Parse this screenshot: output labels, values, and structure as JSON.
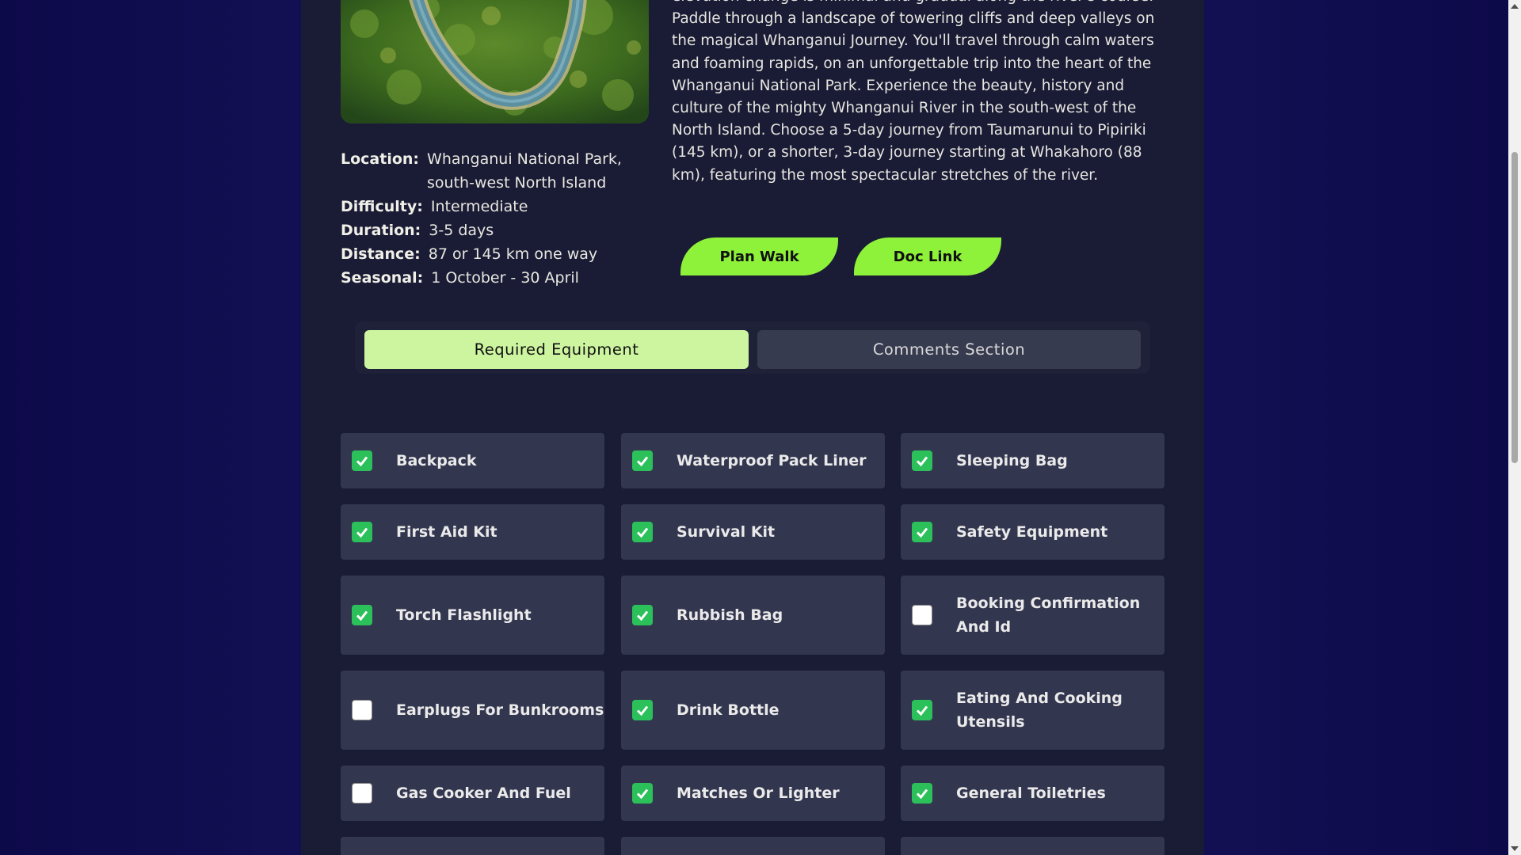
{
  "track": {
    "image_alt": "Whanganui River bend aerial view",
    "description": "elevation change is minimal and gradual along the river's course. Paddle through a landscape of towering cliffs and deep valleys on the magical Whanganui Journey. You'll travel through calm waters and foaming rapids, on an unforgettable trip into the heart of the Whanganui National Park. Experience the beauty, history and culture of the mighty Whanganui River in the south-west of the North Island. Choose a 5-day journey from Taumarunui to Pipiriki (145 km), or a shorter, 3-day journey starting at Whakahoro (88 km), featuring the most spectacular stretches of the river.",
    "info": [
      {
        "label": "Location:",
        "value": "Whanganui National Park, south-west North Island"
      },
      {
        "label": "Difficulty:",
        "value": "Intermediate"
      },
      {
        "label": "Duration:",
        "value": "3-5 days"
      },
      {
        "label": "Distance:",
        "value": "87 or 145 km one way"
      },
      {
        "label": "Seasonal:",
        "value": "1 October - 30 April"
      }
    ]
  },
  "buttons": {
    "plan_walk": "Plan Walk",
    "doc_link": "Doc Link"
  },
  "tabs": {
    "required_equipment": "Required Equipment",
    "comments_section": "Comments Section"
  },
  "equipment": [
    {
      "label": "Backpack",
      "checked": true
    },
    {
      "label": "Waterproof Pack Liner",
      "checked": true
    },
    {
      "label": "Sleeping Bag",
      "checked": true
    },
    {
      "label": "First Aid Kit",
      "checked": true
    },
    {
      "label": "Survival Kit",
      "checked": true
    },
    {
      "label": "Safety Equipment",
      "checked": true
    },
    {
      "label": "Torch Flashlight",
      "checked": true
    },
    {
      "label": "Rubbish Bag",
      "checked": true
    },
    {
      "label": "Booking Confirmation And Id",
      "checked": false
    },
    {
      "label": "Earplugs For Bunkrooms",
      "checked": false
    },
    {
      "label": "Drink Bottle",
      "checked": true
    },
    {
      "label": "Eating And Cooking Utensils",
      "checked": true
    },
    {
      "label": "Gas Cooker And Fuel",
      "checked": false
    },
    {
      "label": "Matches Or Lighter",
      "checked": true
    },
    {
      "label": "General Toiletries",
      "checked": true
    }
  ],
  "colors": {
    "accent": "#8ef23a",
    "tab_active": "#cdf5a0",
    "check": "#2bc05a",
    "card": "#33364f",
    "panel": "#1a1b35"
  }
}
